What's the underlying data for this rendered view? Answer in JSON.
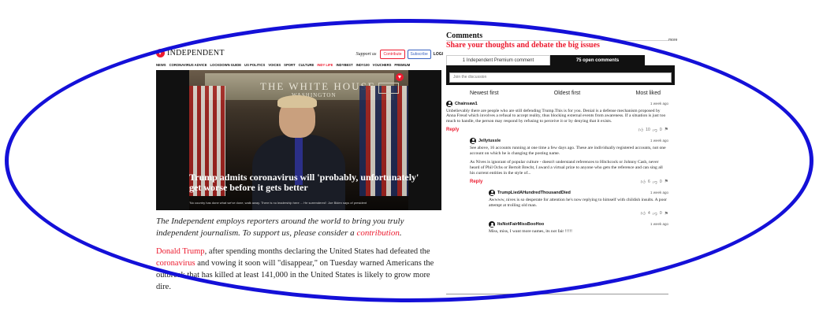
{
  "header": {
    "brand": "INDEPENDENT",
    "support": "Support us",
    "contribute": "Contribute",
    "subscribe": "Subscribe",
    "login": "LOGI"
  },
  "nav": {
    "items": [
      "NEWS",
      "CORONAVIRUS ADVICE",
      "LOCKDOWN GUIDE",
      "US POLITICS",
      "VOICES",
      "SPORT",
      "CULTURE",
      "INDY LIFE",
      "INDYBEST",
      "INDY100",
      "VOUCHERS",
      "PREMIUM"
    ],
    "active_index": 7
  },
  "video": {
    "backdrop_text": "THE WHITE HOUSE",
    "backdrop_sub": "WASHINGTON",
    "headline": "Trump admits coronavirus will 'probably, unfortunately' get worse before it gets better",
    "caption": "'No country has done what we've done, walk away. There is no leadership here ... He surrendered': Joe Biden says of president"
  },
  "promo": {
    "text": "The Independent employs reporters around the world to bring you truly independent journalism. To support us, please consider a ",
    "link": "contribution",
    "end": "."
  },
  "article": {
    "link1": "Donald Trump",
    "text1": ", after spending months declaring the United States had defeated the ",
    "link2": "coronavirus",
    "text2": " and vowing it soon will \"disappear,\" on Tuesday warned Americans the outbreak that has killed at least 141,000 in the United States is likely to grow more dire."
  },
  "comments": {
    "title": "Comments",
    "subtitle": "Share your thoughts and debate the big issues",
    "more": "more",
    "tab_premium": "1 Independent Premium comment",
    "tab_open": "75 open comments",
    "join_placeholder": "Join the discussion",
    "sort": [
      "Newest first",
      "Oldest first",
      "Most liked"
    ],
    "reply_label": "Reply",
    "list": [
      {
        "user": "Chainsaw1",
        "time": "1 week ago",
        "text": "Unbelievably there are people who are still defending Trump.This is for you. Denial is a defense mechanism proposed by Anna Freud which involves a refusal to accept reality, thus blocking external events from awareness. If a situation is just too much to handle, the person may respond by refusing to perceive it or by denying that it exists.",
        "likes": "10",
        "dislikes": "0"
      },
      {
        "user": "Jellytussle",
        "time": "1 week ago",
        "text": "See above, 16 accounts running at one time a few days ago. These are individually registered accounts, not one account on which he is changing the posting name.",
        "text2": "As Nives is ignorant of popular culture - doesn't understand references to Hitchcock or Johnny Cash, never heard of Phil Ochs or Bertolt Brecht, I award a virtual prize to anyone who gets the reference and can sing all his current entities in the style of...",
        "likes": "6",
        "dislikes": "0"
      },
      {
        "user": "TrumpLiedAHundredThousandDied",
        "time": "1 week ago",
        "text": "Awwww, nives is so desperate for attention he's now replying to himself with childish insults. A poor attempt at trolling old man.",
        "likes": "4",
        "dislikes": "0"
      },
      {
        "user": "ItsNotFairMissBooHoo",
        "time": "1 week ago",
        "text": "Miss, miss, I want more names, its not fair !!!!!",
        "likes": "",
        "dislikes": ""
      }
    ]
  },
  "colors": {
    "brand_red": "#ec1a2e",
    "annotation_blue": "#1410d8"
  }
}
